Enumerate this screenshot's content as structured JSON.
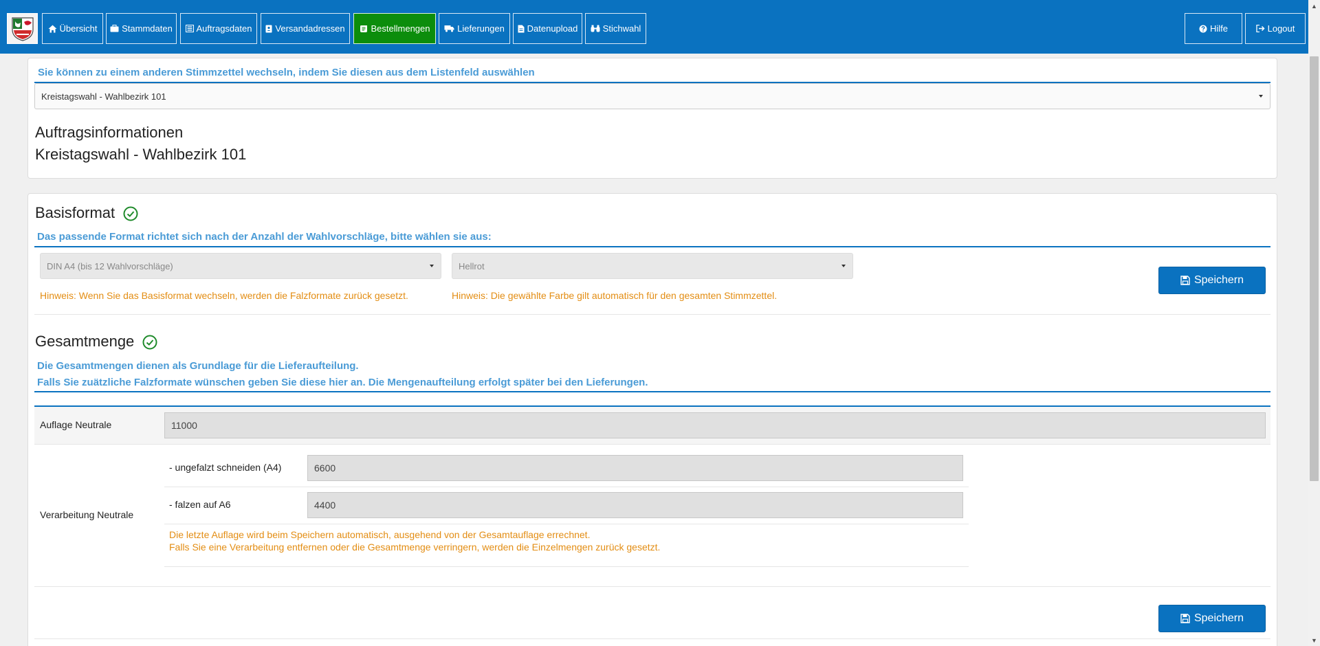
{
  "nav": {
    "logo_icon": "coat-of-arms-nrw",
    "items": [
      {
        "label": "Übersicht",
        "icon": "home-icon"
      },
      {
        "label": "Stammdaten",
        "icon": "briefcase-icon"
      },
      {
        "label": "Auftragsdaten",
        "icon": "list-icon"
      },
      {
        "label": "Versandadressen",
        "icon": "address-card-icon"
      },
      {
        "label": "Bestellmengen",
        "icon": "scroll-icon",
        "active": true
      },
      {
        "label": "Lieferungen",
        "icon": "truck-icon"
      },
      {
        "label": "Datenupload",
        "icon": "file-icon"
      },
      {
        "label": "Stichwahl",
        "icon": "binoculars-icon"
      }
    ],
    "help_label": "Hilfe",
    "logout_label": "Logout",
    "colors": {
      "primary": "#0a72c0",
      "active": "#0c8d0c"
    }
  },
  "ballot_switch": {
    "label": "Sie können zu einem anderen Stimmzettel wechseln, indem Sie diesen aus dem Listenfeld auswählen",
    "selected": "Kreistagswahl - Wahlbezirk 101"
  },
  "order_info": {
    "title": "Auftragsinformationen",
    "subtitle": "Kreistagswahl - Wahlbezirk 101"
  },
  "basisformat": {
    "title": "Basisformat",
    "status_icon": "check-circle-icon",
    "description": "Das passende Format richtet sich nach der Anzahl der Wahlvorschläge, bitte wählen sie aus:",
    "format_selected": "DIN A4 (bis 12 Wahlvorschläge)",
    "color_selected": "Hellrot",
    "format_hint": "Hinweis: Wenn Sie das Basisformat wechseln, werden die Falzformate zurück gesetzt.",
    "color_hint": "Hinweis: Die gewählte Farbe gilt automatisch für den gesamten Stimmzettel.",
    "save_label": "Speichern"
  },
  "gesamtmenge": {
    "title": "Gesamtmenge",
    "status_icon": "check-circle-icon",
    "description_line1": "Die Gesamtmengen dienen als Grundlage für die Lieferaufteilung.",
    "description_line2": "Falls Sie zuätzliche Falzformate wünschen geben Sie diese hier an. Die Mengenaufteilung erfolgt später bei den Lieferungen.",
    "auflage_label": "Auflage Neutrale",
    "auflage_value": "11000",
    "verarbeitung_label": "Verarbeitung Neutrale",
    "rows": [
      {
        "label": "- ungefalzt schneiden (A4)",
        "value": "6600"
      },
      {
        "label": "- falzen auf A6",
        "value": "4400"
      }
    ],
    "hint_line1": "Die letzte Auflage wird beim Speichern automatisch, ausgehend von der Gesamtauflage errechnet.",
    "hint_line2": "Falls Sie eine Verarbeitung entfernen oder die Gesamtmenge verringern, werden die Einzelmengen zurück gesetzt.",
    "save_label": "Speichern",
    "colors": {
      "hint": "#e38d13",
      "label": "#4a9bd6"
    }
  }
}
